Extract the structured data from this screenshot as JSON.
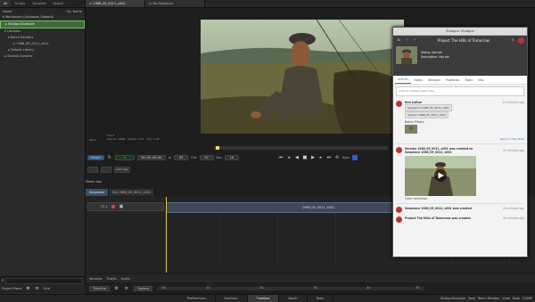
{
  "left_panel": {
    "tabs": [
      "All",
      "Scripts",
      "Libraries",
      "Search"
    ],
    "column_label": "Name",
    "sort_label": "Op: Name",
    "items": [
      {
        "label": "Workspace (Autosave_Sideout)",
        "level": 0
      },
      {
        "label": "ShotgunExample",
        "level": 1,
        "selected": true
      },
      {
        "label": "Libraries",
        "level": 1
      },
      {
        "label": "Batch Renders",
        "level": 2
      },
      {
        "label": "1988_05_0011_v001",
        "level": 3
      },
      {
        "label": "Default Library",
        "level": 2
      },
      {
        "label": "Shared Libraries",
        "level": 1
      }
    ],
    "footer": {
      "search_placeholder": "",
      "button1": "Project Panel",
      "button2": "Grid"
    }
  },
  "viewer": {
    "tabs": [
      "1988_05_0011_v001",
      "No Sequence"
    ],
    "info_lines": [
      "Info ▾",
      "Gamut: sRGB",
      "Shape: 1.00",
      "Clip: 1.00"
    ],
    "info_side": [
      "Mono",
      "Frame: 1.00",
      "Timecode: 1.00",
      "Gamma: 1.0"
    ],
    "transport": {
      "player_label": "Player",
      "frame": "1",
      "timecode": "00:00:00:00",
      "in_label": "In",
      "in_value": "83",
      "out_label": "Out",
      "out_value": "92",
      "dur_label": "Dur",
      "dur_value": "10",
      "zoom_label": "Sync"
    },
    "sequence_tabs": [
      "Sequence",
      "Bin 1988_05_0011_v001"
    ],
    "track_label": "V1.1",
    "clip_label": "1988_05_0011_v001",
    "media_track": "Media tool",
    "bottom_tabs": [
      "Versions",
      "Tracks",
      "Audio"
    ],
    "timeline_label": "Timeline",
    "options_label": "Options",
    "ruler": [
      "01",
      "11",
      "21",
      "31",
      "41",
      "51"
    ]
  },
  "shotgun_panel": {
    "window_title": "Shotgun: Shotgun",
    "project_title": "Project The Hills of Tomorrow",
    "status": "Status: Not set",
    "description": "Description: Not set",
    "tabs": [
      "Activity",
      "Notes",
      "Versions",
      "Publishes",
      "Tasks",
      "Info"
    ],
    "new_note_placeholder": "Click to create a new note...",
    "activity": [
      {
        "author": "Ken LaRue",
        "time": "11 minutes ago",
        "chips": [
          "Sequence 1988_05_0011_v001",
          "Version 1988_05_0011_v001"
        ],
        "body": "Better Please.",
        "reply": "Reply to this Note"
      },
      {
        "author": "",
        "time": "24 minutes ago",
        "text": "Version 1988_05_0011_v001 was created on Sequence 1988_05_0011_v001",
        "caption": "Color correction"
      },
      {
        "author": "",
        "time": "26 minutes ago",
        "text": "Sequence 1988_05_0011_v001 was created"
      },
      {
        "author": "",
        "time": "28 minutes ago",
        "text": "Project The Hills of Tomorrow was created"
      }
    ]
  },
  "bottom_bar": {
    "tabs": [
      "Preferences",
      "Conform",
      "Timeline",
      "Batch",
      "Tools"
    ],
    "active_tab": "Timeline",
    "project": "ShotgunExample",
    "save": "Save",
    "renders": "Batch Renders",
    "undo": "Undo",
    "redo": "Redo",
    "brand": "FLAME"
  },
  "colors": {
    "accent": "#2a7fc0",
    "selection_green": "#6fbf5a",
    "playhead": "#e6c83a",
    "in_marker": "#f2e23b"
  }
}
